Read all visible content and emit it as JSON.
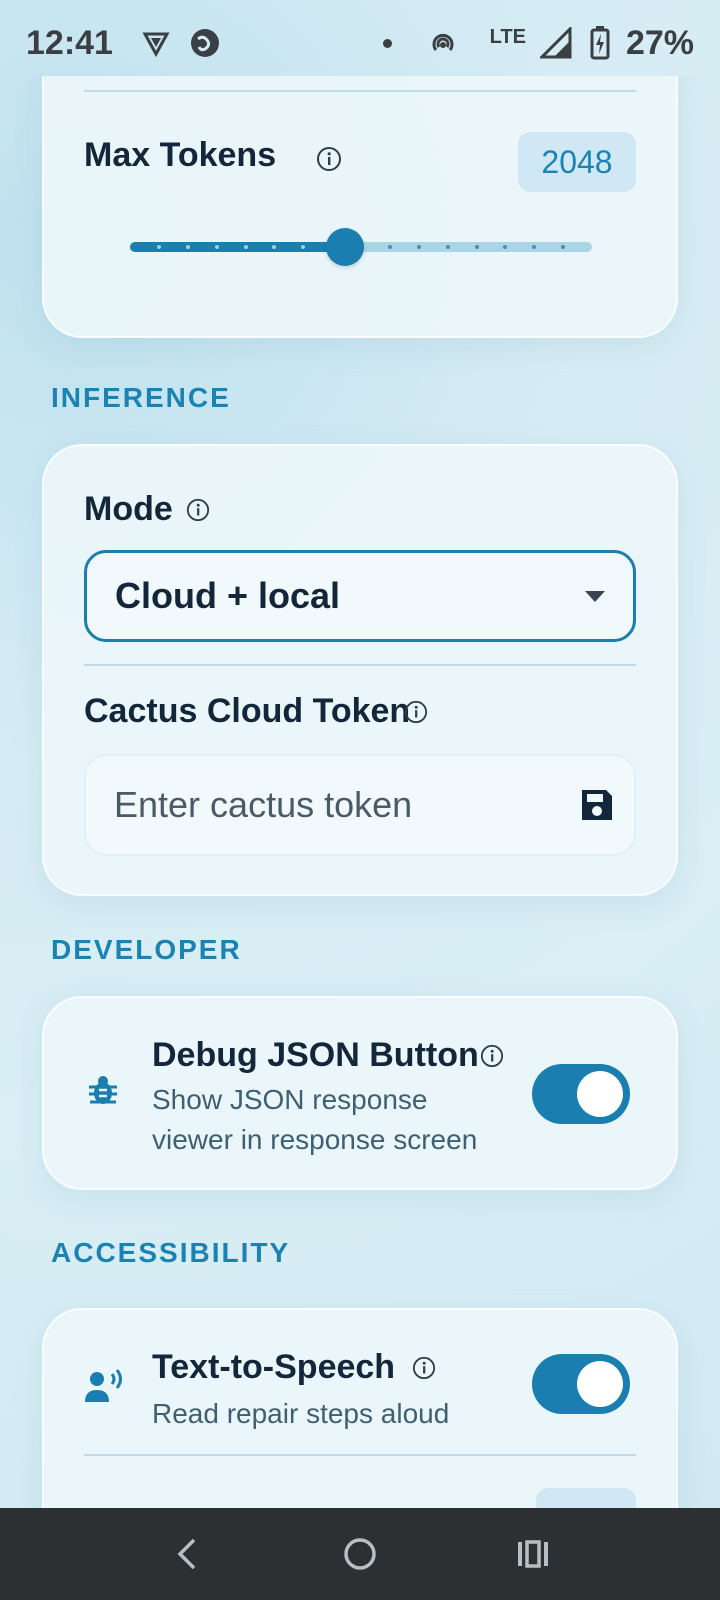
{
  "status_bar": {
    "time": "12:41",
    "network": "LTE",
    "battery": "27%"
  },
  "model_card": {
    "max_tokens_label": "Max Tokens",
    "max_tokens_value": "2048",
    "slider_fraction": 0.465
  },
  "inference": {
    "header": "INFERENCE",
    "mode_label": "Mode",
    "mode_value": "Cloud + local",
    "token_label": "Cactus Cloud Token",
    "token_placeholder": "Enter cactus token"
  },
  "developer": {
    "header": "DEVELOPER",
    "debug_title": "Debug JSON Button",
    "debug_subtitle_line1": "Show JSON response",
    "debug_subtitle_line2": "viewer in response screen",
    "debug_enabled": true
  },
  "accessibility": {
    "header": "ACCESSIBILITY",
    "tts_title": "Text-to-Speech",
    "tts_subtitle": "Read repair steps aloud",
    "tts_enabled": true
  },
  "colors": {
    "accent": "#1a7fb0",
    "section_header": "#1b83b3",
    "nav_bar": "#2c3033"
  },
  "icons": {
    "info": "info-circle-icon",
    "save": "floppy-disk-icon",
    "debug": "bug-icon",
    "tts": "speaking-person-icon",
    "nav_back": "chevron-left-icon",
    "nav_home": "circle-home-icon",
    "nav_recents": "recents-icon"
  }
}
